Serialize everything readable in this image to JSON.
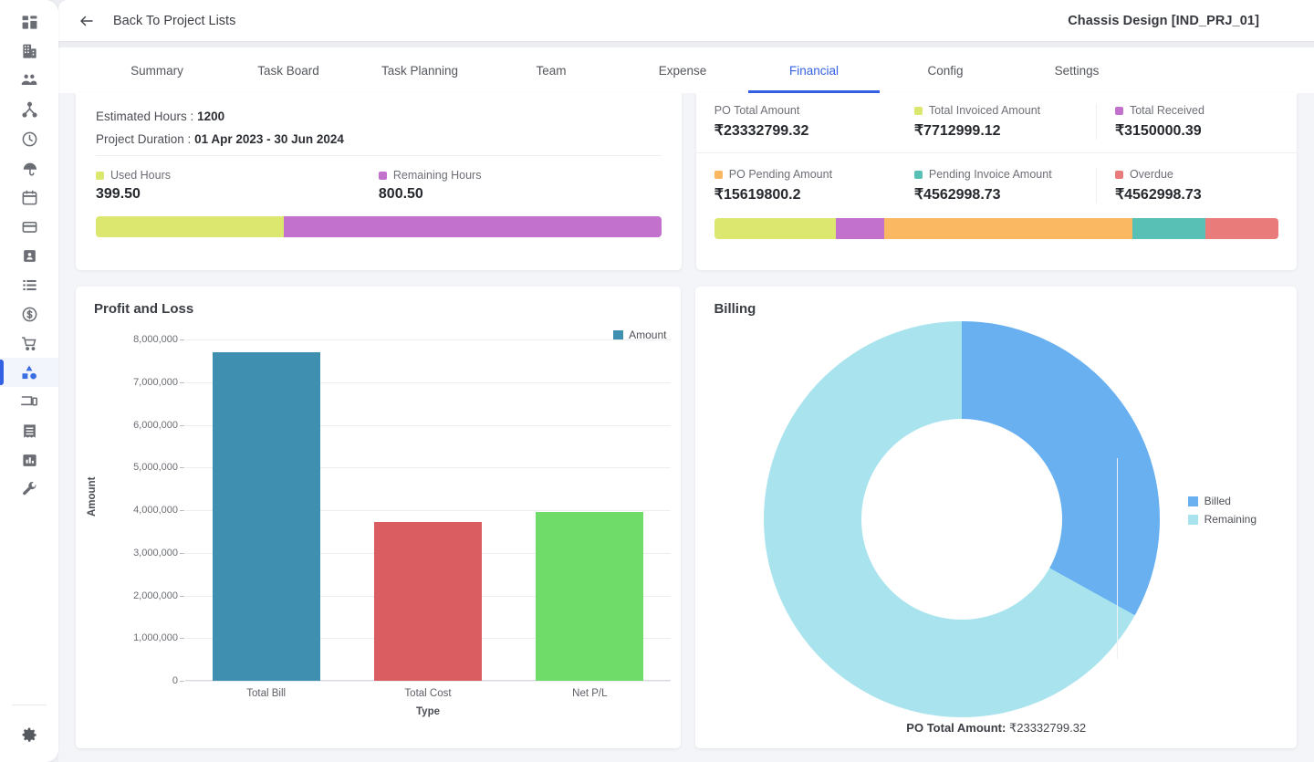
{
  "sidebar": {
    "items": [
      {
        "name": "dashboard-icon",
        "label": "Dashboard"
      },
      {
        "name": "company-icon",
        "label": "Company"
      },
      {
        "name": "users-icon",
        "label": "Users"
      },
      {
        "name": "hierarchy-icon",
        "label": "Hierarchy"
      },
      {
        "name": "time-icon",
        "label": "Timesheet"
      },
      {
        "name": "leave-icon",
        "label": "Leave"
      },
      {
        "name": "calendar-icon",
        "label": "Calendar"
      },
      {
        "name": "card-icon",
        "label": "Payments"
      },
      {
        "name": "contact-card-icon",
        "label": "Contacts"
      },
      {
        "name": "list-icon",
        "label": "Lists"
      },
      {
        "name": "dollar-icon",
        "label": "Finance"
      },
      {
        "name": "cart-icon",
        "label": "Purchase"
      },
      {
        "name": "shapes-icon",
        "label": "Projects"
      },
      {
        "name": "devices-icon",
        "label": "Assets"
      },
      {
        "name": "invoice-icon",
        "label": "Invoices"
      },
      {
        "name": "bar-chart-icon",
        "label": "Reports"
      },
      {
        "name": "wrench-icon",
        "label": "Tools"
      }
    ],
    "active_index": 12,
    "settings": {
      "name": "gear-icon",
      "label": "Settings"
    }
  },
  "topbar": {
    "back_icon": "arrow-left-icon",
    "back_label": "Back To Project Lists",
    "project_title": "Chassis Design [IND_PRJ_01]"
  },
  "tabs": {
    "items": [
      "Summary",
      "Task Board",
      "Task Planning",
      "Team",
      "Expense",
      "Financial",
      "Config",
      "Settings"
    ],
    "active": "Financial"
  },
  "hours_card": {
    "estimated_hours_label": "Estimated Hours :",
    "estimated_hours_value": "1200",
    "project_duration_label": "Project Duration :",
    "project_duration_value": "01 Apr 2023 - 30 Jun 2024",
    "used": {
      "label": "Used Hours",
      "value": "399.50",
      "color": "#dbe76e",
      "pct": 33.29
    },
    "remaining": {
      "label": "Remaining Hours",
      "value": "800.50",
      "color": "#c272cd",
      "pct": 66.71
    }
  },
  "amounts_card": {
    "row1": [
      {
        "label": "PO Total Amount",
        "value": "₹23332799.32",
        "color": null,
        "bordered": false
      },
      {
        "label": "Total Invoiced Amount",
        "value": "₹7712999.12",
        "color": "#dbe76e",
        "bordered": false
      },
      {
        "label": "Total Received",
        "value": "₹3150000.39",
        "color": "#c272cd",
        "bordered": true
      }
    ],
    "row2": [
      {
        "label": "PO Pending Amount",
        "value": "₹15619800.2",
        "color": "#fbb862",
        "bordered": false
      },
      {
        "label": "Pending Invoice Amount",
        "value": "₹4562998.73",
        "color": "#59c0b5",
        "bordered": false
      },
      {
        "label": "Overdue",
        "value": "₹4562998.73",
        "color": "#e97b7b",
        "bordered": true
      }
    ],
    "stack": [
      {
        "name": "total-invoiced",
        "color": "#dbe76e",
        "pct": 21.5
      },
      {
        "name": "total-received",
        "color": "#c272cd",
        "pct": 8.7
      },
      {
        "name": "po-pending",
        "color": "#fbb862",
        "pct": 44.0
      },
      {
        "name": "pending-invoice",
        "color": "#59c0b5",
        "pct": 12.9
      },
      {
        "name": "overdue",
        "color": "#e97b7b",
        "pct": 12.9
      }
    ]
  },
  "chart_data": [
    {
      "type": "bar",
      "title": "Profit and Loss",
      "categories": [
        "Total Bill",
        "Total Cost",
        "Net P/L"
      ],
      "values": [
        7700000,
        3720000,
        3970000
      ],
      "colors": [
        "#3f8fb0",
        "#d95d61",
        "#6fdb68"
      ],
      "series": [
        {
          "name": "Amount",
          "values": [
            7700000,
            3720000,
            3970000
          ]
        }
      ],
      "legend": [
        "Amount"
      ],
      "legend_position": "top-right",
      "xlabel": "Type",
      "ylabel": "Amount",
      "ylim": [
        0,
        8000000
      ],
      "yticks": [
        "8,000,000",
        "7,000,000",
        "6,000,000",
        "5,000,000",
        "4,000,000",
        "3,000,000",
        "2,000,000",
        "1,000,000",
        "0"
      ],
      "grid": true
    },
    {
      "type": "pie",
      "title": "Billing",
      "donut": true,
      "labels": [
        "Billed",
        "Remaining"
      ],
      "values": [
        7712999.12,
        15619800.2
      ],
      "percents": [
        33.06,
        66.94
      ],
      "colors": [
        "#68b0f0",
        "#a9e4ee"
      ],
      "legend_position": "right",
      "footer_label": "PO Total Amount:",
      "footer_value": "₹23332799.32"
    }
  ]
}
